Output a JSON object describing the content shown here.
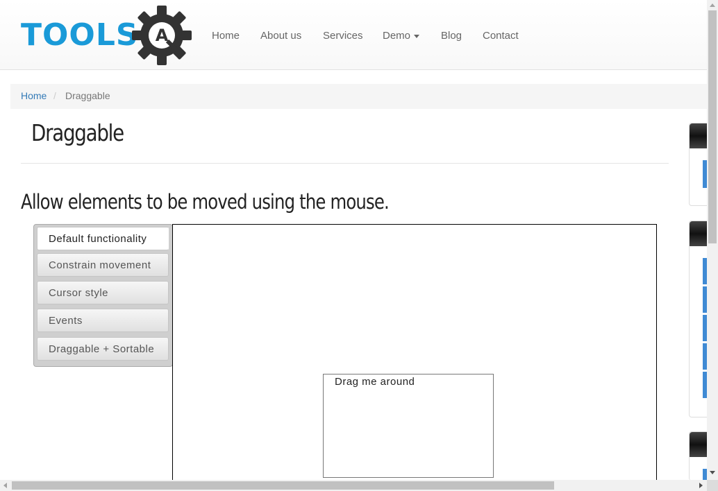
{
  "logo": {
    "text": "TOOLS",
    "emblem_letter": "A",
    "icon": "gear-icon",
    "colors": {
      "text": "#1a9ad8",
      "gear": "#333333"
    }
  },
  "nav": {
    "items": [
      {
        "label": "Home"
      },
      {
        "label": "About us"
      },
      {
        "label": "Services"
      },
      {
        "label": "Demo",
        "has_dropdown": true
      },
      {
        "label": "Blog"
      },
      {
        "label": "Contact"
      }
    ]
  },
  "breadcrumb": {
    "home": "Home",
    "separator": "/",
    "current": "Draggable"
  },
  "page": {
    "title": "Draggable",
    "subtitle": "Allow elements to be moved using the mouse."
  },
  "tabs": [
    {
      "label": "Default functionality",
      "active": true
    },
    {
      "label": "Constrain movement",
      "active": false
    },
    {
      "label": "Cursor style",
      "active": false
    },
    {
      "label": "Events",
      "active": false
    },
    {
      "label": "Draggable + Sortable",
      "active": false
    }
  ],
  "demo": {
    "draggable_text": "Drag me around"
  },
  "colors": {
    "link": "#337ab7",
    "sidebar_accent": "#3f8ad4"
  }
}
